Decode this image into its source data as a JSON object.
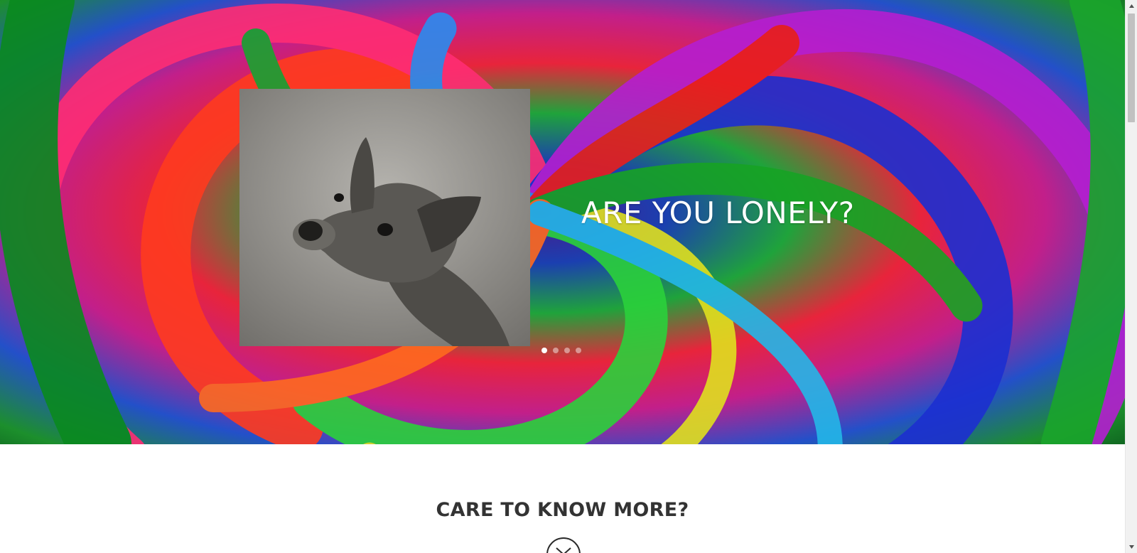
{
  "hero": {
    "slide_title": "ARE YOU LONELY?",
    "slide_image": "dog-photo",
    "dots": [
      {
        "label": "slide 1",
        "active": true
      },
      {
        "label": "slide 2",
        "active": false
      },
      {
        "label": "slide 3",
        "active": false
      },
      {
        "label": "slide 4",
        "active": false
      }
    ]
  },
  "section": {
    "heading": "CARE TO KNOW MORE?",
    "scroll_icon": "chevron-down-circle-icon"
  },
  "colors": {
    "background": "#ffffff",
    "heading_text": "#333333",
    "hero_text": "#ffffff"
  }
}
